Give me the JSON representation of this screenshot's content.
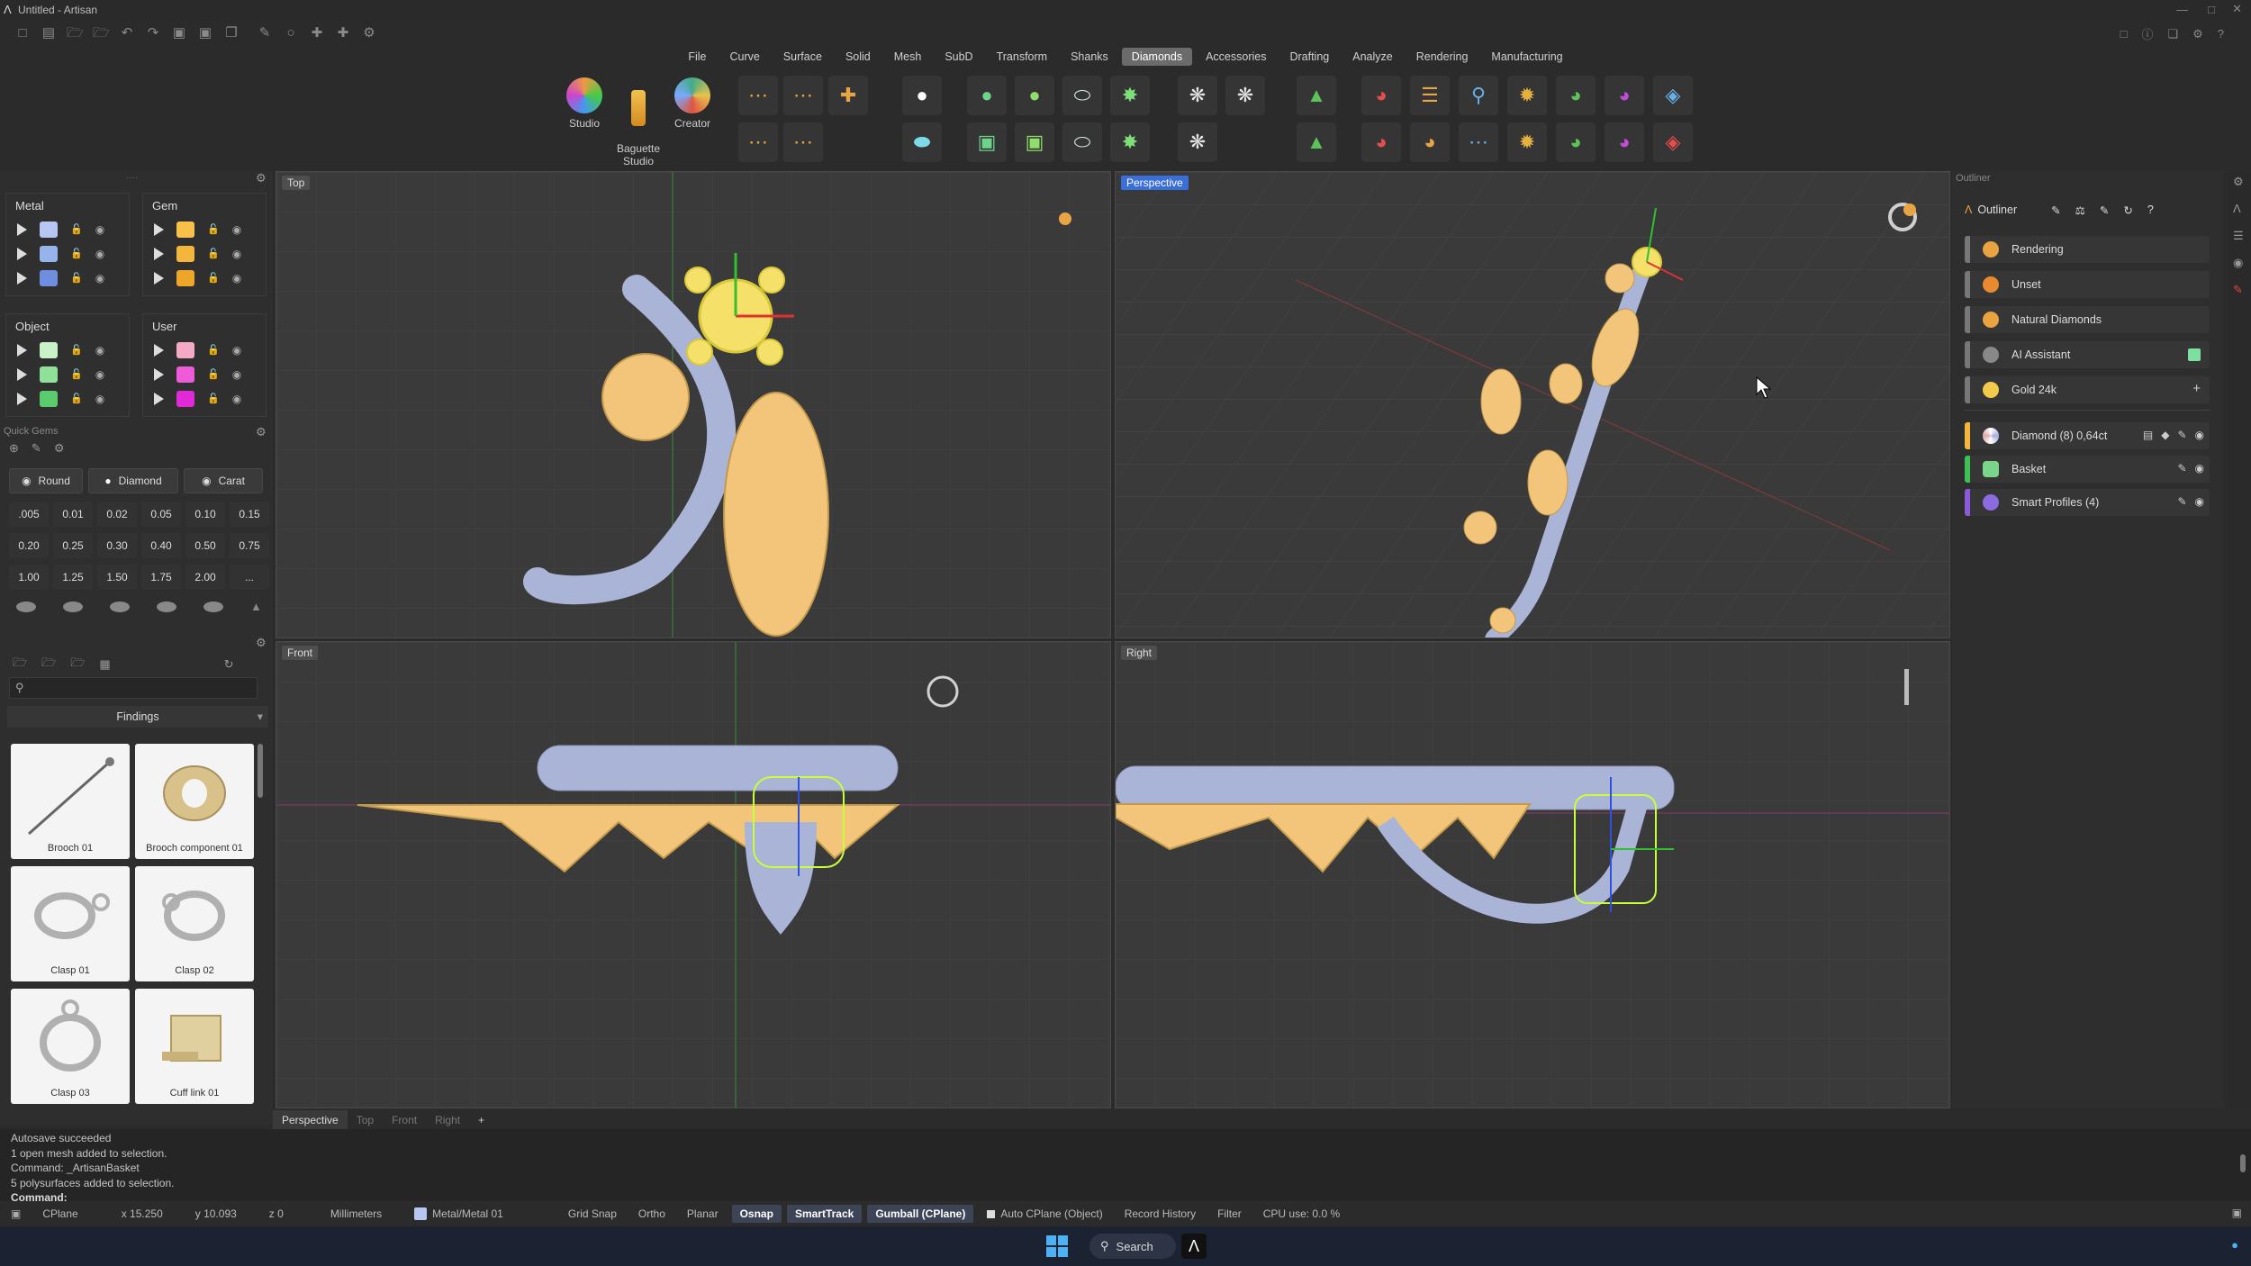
{
  "window": {
    "title": "Untitled - Artisan"
  },
  "menu": [
    "File",
    "Curve",
    "Surface",
    "Solid",
    "Mesh",
    "SubD",
    "Transform",
    "Shanks",
    "Diamonds",
    "Accessories",
    "Drafting",
    "Analyze",
    "Rendering",
    "Manufacturing"
  ],
  "menu_active": "Diamonds",
  "ribbon": {
    "studio": "Studio",
    "baguette_studio": "Baguette\nStudio",
    "creator": "Creator"
  },
  "layers": {
    "metal": {
      "title": "Metal",
      "colors": [
        "#b7c7f2",
        "#96b3ec",
        "#6f8ee0"
      ]
    },
    "gem": {
      "title": "Gem",
      "colors": [
        "#f8c24a",
        "#f3b53c",
        "#eda52a"
      ]
    },
    "object": {
      "title": "Object",
      "colors": [
        "#c9f2c9",
        "#90e09a",
        "#5acc6d"
      ]
    },
    "user": {
      "title": "User",
      "colors": [
        "#f6a9c6",
        "#ed5bd8",
        "#e02ad8"
      ]
    }
  },
  "quick_gems": {
    "title": "Quick Gems",
    "shape": "Round",
    "material": "Diamond",
    "unit": "Carat",
    "sizes": [
      ".005",
      "0.01",
      "0.02",
      "0.05",
      "0.10",
      "0.15",
      "0.20",
      "0.25",
      "0.30",
      "0.40",
      "0.50",
      "0.75",
      "1.00",
      "1.25",
      "1.50",
      "1.75",
      "2.00",
      "..."
    ]
  },
  "library": {
    "search_placeholder": "",
    "category": "Findings",
    "items": [
      "Brooch 01",
      "Brooch component 01",
      "Clasp 01",
      "Clasp 02",
      "Clasp 03",
      "Cuff link 01"
    ]
  },
  "viewports": {
    "top": "Top",
    "perspective": "Perspective",
    "front": "Front",
    "right": "Right"
  },
  "viewport_tabs": [
    "Perspective",
    "Top",
    "Front",
    "Right"
  ],
  "outliner": {
    "title": "Outliner",
    "header": "Outliner",
    "groups": [
      {
        "label": "Rendering",
        "icon_color": "#e9a340"
      },
      {
        "label": "Unset",
        "icon_color": "#e98a30"
      },
      {
        "label": "Natural Diamonds",
        "icon_color": "#e9a340"
      },
      {
        "label": "AI Assistant",
        "icon_color": "#888888"
      },
      {
        "label": "Gold 24k",
        "icon_color": "#f2c94c"
      }
    ],
    "objects": [
      {
        "label": "Diamond (8) 0,64ct",
        "bar_color": "#f3b53c"
      },
      {
        "label": "Basket",
        "bar_color": "#3fbf55"
      },
      {
        "label": "Smart Profiles (4)",
        "bar_color": "#8a5bd8"
      }
    ]
  },
  "command_history": [
    "Autosave succeeded",
    "1 open mesh added to selection.",
    "Command: _ArtisanBasket",
    "5 polysurfaces added to selection."
  ],
  "command_prompt": "Command:",
  "status": {
    "cplane": "CPlane",
    "x": "x 15.250",
    "y": "y 10.093",
    "z": "z 0",
    "units": "Millimeters",
    "layer": "Metal/Metal 01",
    "grid_snap": "Grid Snap",
    "ortho": "Ortho",
    "planar": "Planar",
    "osnap": "Osnap",
    "smarttrack": "SmartTrack",
    "gumball": "Gumball (CPlane)",
    "auto_cplane": "Auto CPlane (Object)",
    "record_history": "Record History",
    "filter": "Filter",
    "cpu": "CPU use: 0.0 %"
  },
  "taskbar": {
    "search": "Search"
  }
}
